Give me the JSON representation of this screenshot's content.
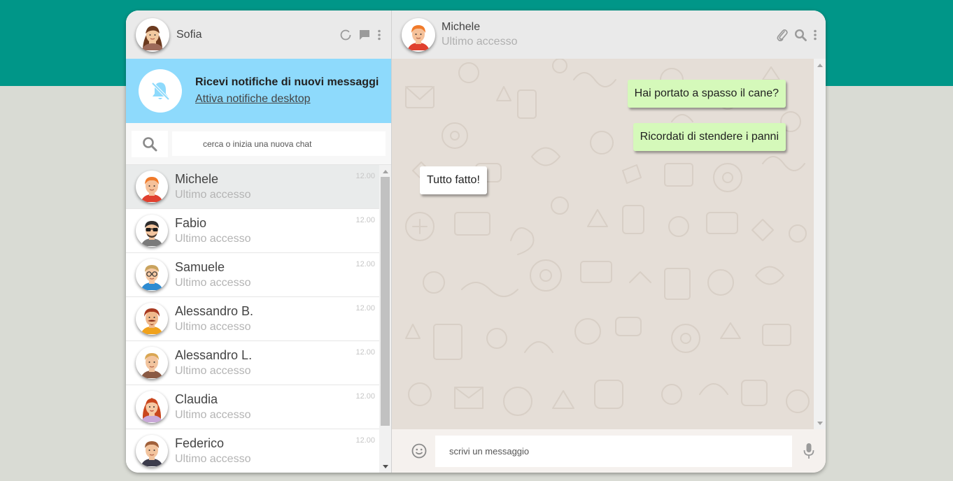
{
  "colors": {
    "brand_band": "#009688",
    "page_bg": "#d9dbd4",
    "banner_bg": "#8edafc",
    "sent_bubble": "#d5f9ba",
    "received_bubble": "#ffffff",
    "chat_bg": "#e5ded7"
  },
  "user": {
    "name": "Sofia",
    "avatar_icon": "avatar-woman-brown-hair-icon"
  },
  "left_header_icons": [
    "status-circle-icon",
    "chat-bubble-icon",
    "kebab-menu-icon"
  ],
  "notification": {
    "title": "Ricevi notifiche di nuovi messaggi",
    "link": "Attiva notifiche desktop",
    "icon": "bell-off-icon"
  },
  "search": {
    "placeholder": "cerca o inizia una nuova chat",
    "icon": "search-icon"
  },
  "contacts": [
    {
      "name": "Michele",
      "status": "Ultimo accesso",
      "time": "12.00",
      "active": true,
      "avatar_icon": "avatar-man-ginger-icon"
    },
    {
      "name": "Fabio",
      "status": "Ultimo accesso",
      "time": "12.00",
      "active": false,
      "avatar_icon": "avatar-man-sunglasses-icon"
    },
    {
      "name": "Samuele",
      "status": "Ultimo accesso",
      "time": "12.00",
      "active": false,
      "avatar_icon": "avatar-man-glasses-icon"
    },
    {
      "name": "Alessandro B.",
      "status": "Ultimo accesso",
      "time": "12.00",
      "active": false,
      "avatar_icon": "avatar-man-mustache-icon"
    },
    {
      "name": "Alessandro L.",
      "status": "Ultimo accesso",
      "time": "12.00",
      "active": false,
      "avatar_icon": "avatar-man-blond-icon"
    },
    {
      "name": "Claudia",
      "status": "Ultimo accesso",
      "time": "12.00",
      "active": false,
      "avatar_icon": "avatar-woman-red-hair-icon"
    },
    {
      "name": "Federico",
      "status": "Ultimo accesso",
      "time": "12.00",
      "active": false,
      "avatar_icon": "avatar-man-brown-hair-icon"
    }
  ],
  "chat": {
    "contact_name": "Michele",
    "contact_status": "Ultimo accesso",
    "header_icons": [
      "paperclip-icon",
      "search-icon",
      "kebab-menu-icon"
    ],
    "messages": [
      {
        "text": "Hai portato a spasso il cane?",
        "direction": "sent"
      },
      {
        "text": "Ricordati di stendere i panni",
        "direction": "sent"
      },
      {
        "text": "Tutto fatto!",
        "direction": "received"
      }
    ]
  },
  "compose": {
    "placeholder": "scrivi un messaggio",
    "emoji_icon": "smiley-icon",
    "mic_icon": "microphone-icon"
  }
}
